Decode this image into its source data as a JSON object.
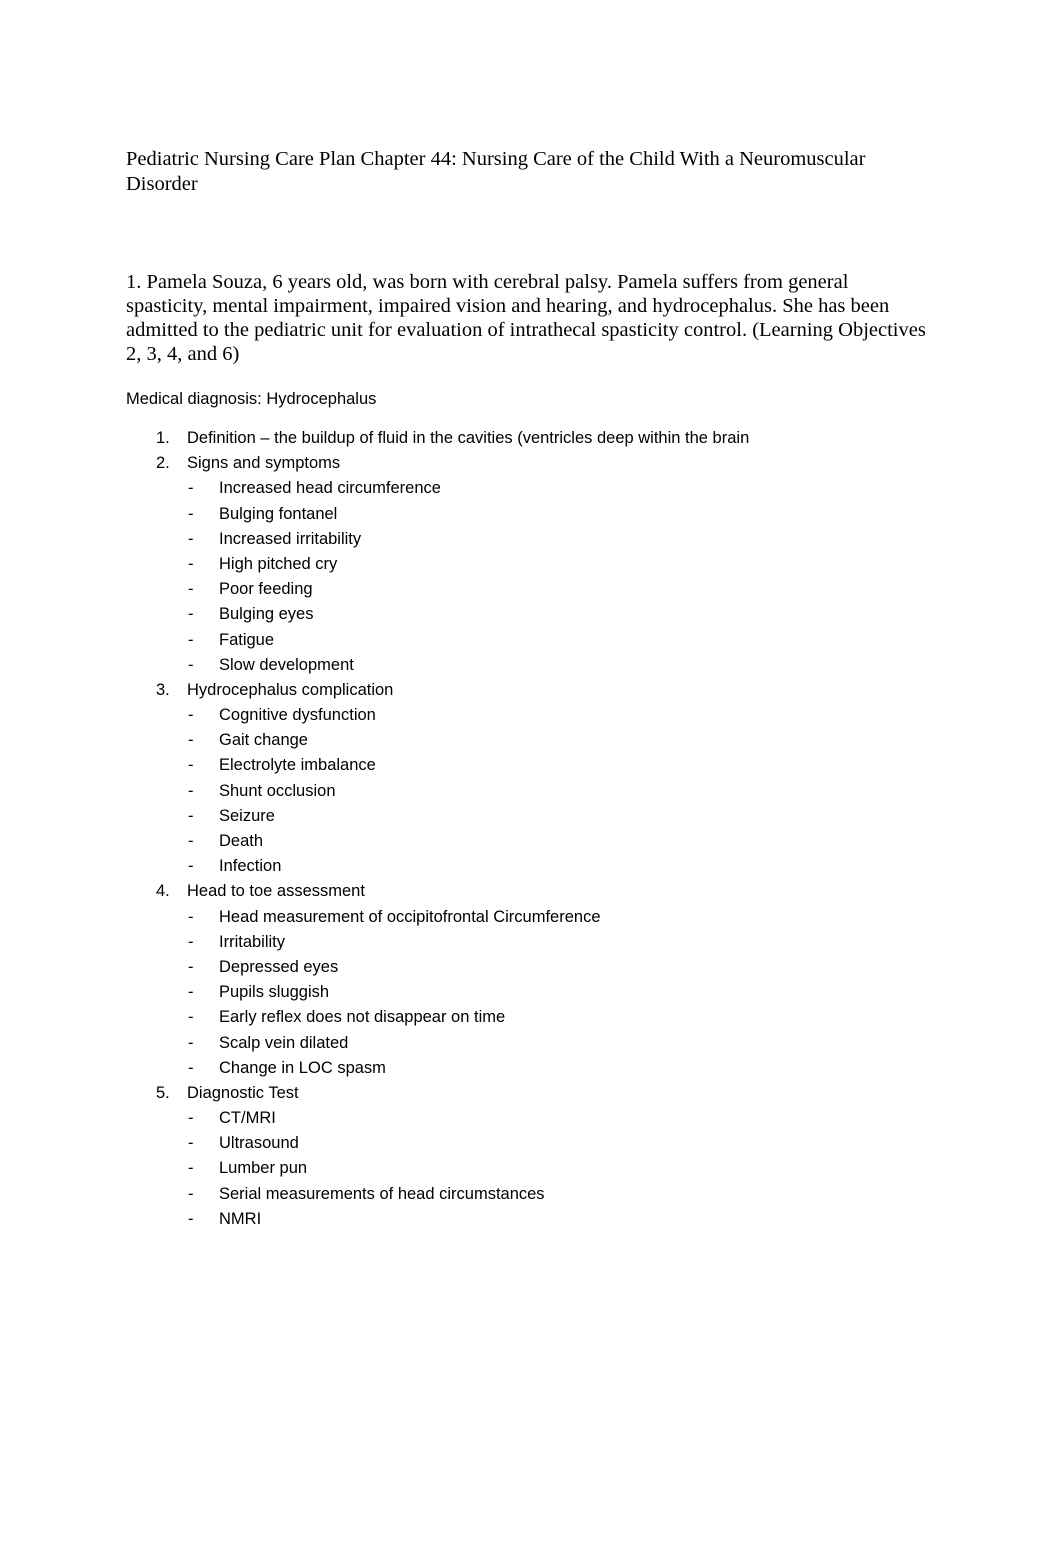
{
  "document": {
    "title": "Pediatric Nursing Care Plan Chapter 44: Nursing Care of the Child With a Neuromuscular Disorder",
    "question": "1. Pamela Souza, 6 years old, was born with cerebral palsy. Pamela suffers from general spasticity, mental impairment, impaired vision and hearing, and hydrocephalus. She has been admitted to the pediatric unit for evaluation of intrathecal spasticity control. (Learning Objectives 2, 3, 4, and 6)",
    "diagnosis": "Medical diagnosis: Hydrocephalus",
    "sub_bullet": "-",
    "sections": [
      {
        "number": "1.",
        "label": "Definition – the buildup of fluid in the cavities (ventricles deep within the brain",
        "items": []
      },
      {
        "number": "2.",
        "label": "Signs and symptoms",
        "items": [
          "Increased head circumference",
          "Bulging fontanel",
          "Increased irritability",
          "High pitched cry",
          "Poor feeding",
          "Bulging eyes",
          "Fatigue",
          "Slow development"
        ]
      },
      {
        "number": "3.",
        "label": "Hydrocephalus complication",
        "items": [
          "Cognitive dysfunction",
          "Gait change",
          "Electrolyte imbalance",
          "Shunt occlusion",
          "Seizure",
          "Death",
          "Infection"
        ]
      },
      {
        "number": "4.",
        "label": "Head to toe assessment",
        "items": [
          "Head measurement of occipitofrontal Circumference",
          "Irritability",
          "Depressed eyes",
          "Pupils sluggish",
          "Early reflex does not disappear on time",
          "Scalp vein dilated",
          "Change in LOC spasm"
        ]
      },
      {
        "number": "5.",
        "label": "Diagnostic Test",
        "items": [
          "CT/MRI",
          "Ultrasound",
          "Lumber pun",
          "Serial measurements of head circumstances",
          "NMRI"
        ]
      }
    ]
  }
}
